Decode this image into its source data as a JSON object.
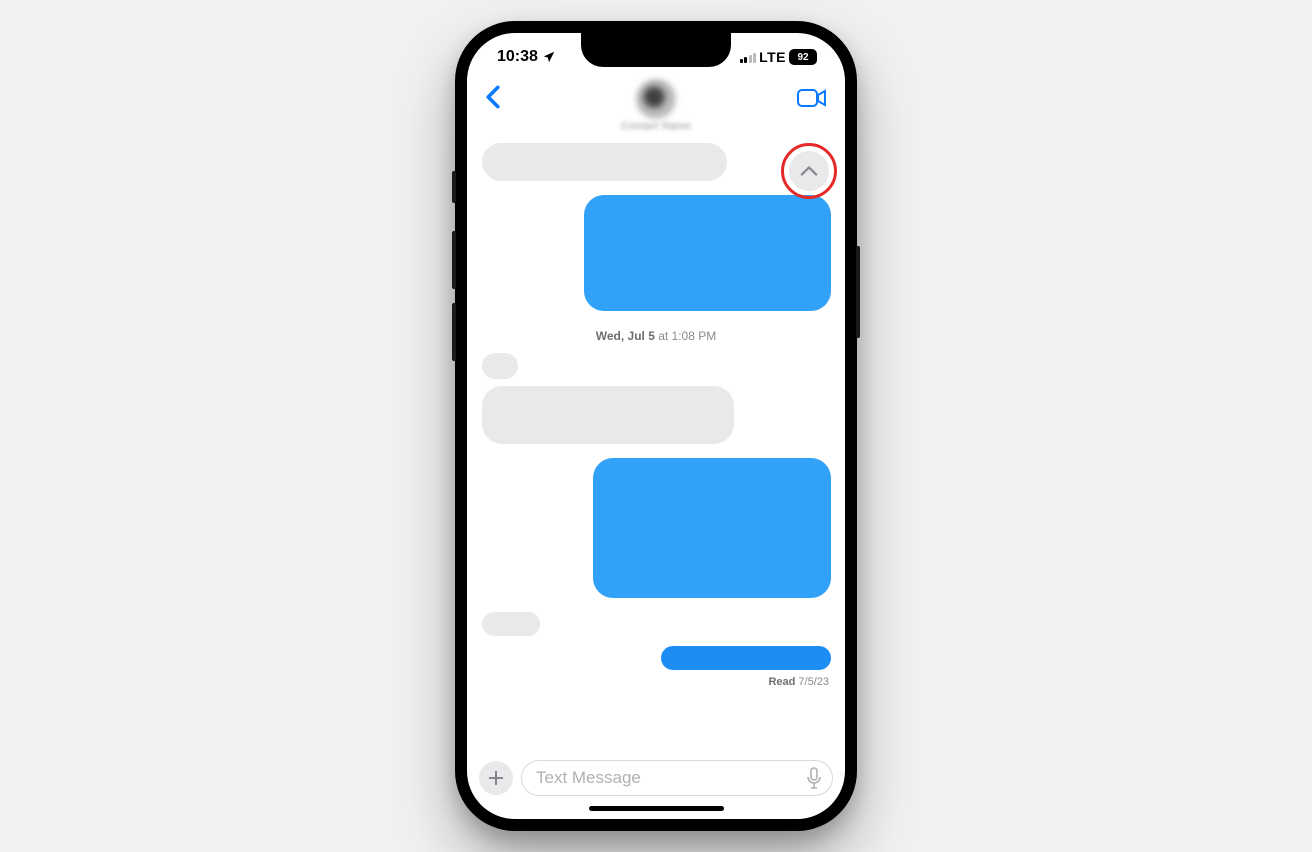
{
  "status": {
    "time": "10:38",
    "carrier": "LTE",
    "battery": "92"
  },
  "header": {
    "contact_name": "Contact Name"
  },
  "conversation": {
    "timestamp_day": "Wed, Jul 5",
    "timestamp_time": " at 1:08 PM",
    "read_label": "Read",
    "read_date": " 7/5/23"
  },
  "input": {
    "placeholder": "Text Message"
  },
  "icons": {
    "location": "location-arrow",
    "back": "chevron-left",
    "video": "video-camera",
    "scroll_up": "chevron-up",
    "plus": "plus",
    "mic": "microphone"
  }
}
